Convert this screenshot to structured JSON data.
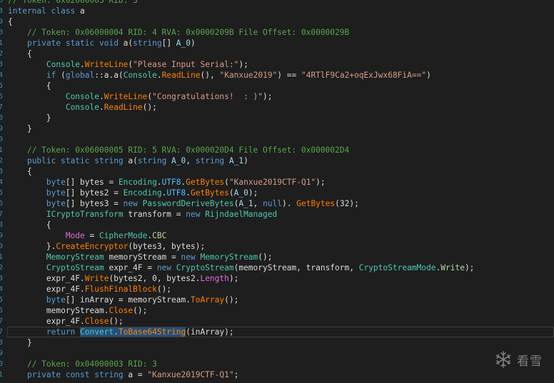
{
  "colors": {
    "background": "#1e1e1e",
    "keyword": "#569cd6",
    "comment": "#57a64a",
    "string": "#d69d85",
    "class": "#4ec9b0",
    "method": "#ff8000",
    "property": "#da70d6",
    "selection": "#264f78",
    "line_number": "#2b91af"
  },
  "watermark": {
    "icon": "snowflake-icon",
    "text": "看雪"
  },
  "current_line_index": 31,
  "lines": [
    {
      "n": "6",
      "tokens": [
        [
          "com",
          "// Token: 0x02000003 RID: 3"
        ]
      ]
    },
    {
      "n": "3",
      "tokens": [
        [
          "kw",
          "internal class "
        ],
        [
          "id",
          "a"
        ]
      ]
    },
    {
      "n": "9",
      "tokens": [
        [
          "id",
          "{"
        ]
      ]
    },
    {
      "n": "0",
      "tokens": [
        [
          "id",
          "    "
        ],
        [
          "com",
          "// Token: 0x06000004 RID: 4 RVA: 0x0000209B File Offset: 0x0000029B"
        ]
      ]
    },
    {
      "n": "1",
      "tokens": [
        [
          "id",
          "    "
        ],
        [
          "kw",
          "private static void "
        ],
        [
          "id",
          "a("
        ],
        [
          "kw",
          "string"
        ],
        [
          "id",
          "[] "
        ],
        [
          "param",
          "A_0"
        ],
        [
          "id",
          ")"
        ]
      ]
    },
    {
      "n": "2",
      "tokens": [
        [
          "id",
          "    {"
        ]
      ]
    },
    {
      "n": "3",
      "tokens": [
        [
          "id",
          "        "
        ],
        [
          "cls",
          "Console"
        ],
        [
          "id",
          "."
        ],
        [
          "mth",
          "WriteLine"
        ],
        [
          "id",
          "("
        ],
        [
          "str",
          "\"Please Input Serial:\""
        ],
        [
          "id",
          ");"
        ]
      ]
    },
    {
      "n": "4",
      "tokens": [
        [
          "id",
          "        "
        ],
        [
          "kw",
          "if "
        ],
        [
          "id",
          "("
        ],
        [
          "kw",
          "global"
        ],
        [
          "id",
          "::a.a("
        ],
        [
          "cls",
          "Console"
        ],
        [
          "id",
          "."
        ],
        [
          "mth",
          "ReadLine"
        ],
        [
          "id",
          "(), "
        ],
        [
          "str",
          "\"Kanxue2019\""
        ],
        [
          "id",
          ") == "
        ],
        [
          "str",
          "\"4RTlF9Ca2+oqExJwx68FiA==\""
        ],
        [
          "id",
          ")"
        ]
      ]
    },
    {
      "n": "5",
      "tokens": [
        [
          "id",
          "        {"
        ]
      ]
    },
    {
      "n": "6",
      "tokens": [
        [
          "id",
          "            "
        ],
        [
          "cls",
          "Console"
        ],
        [
          "id",
          "."
        ],
        [
          "mth",
          "WriteLine"
        ],
        [
          "id",
          "("
        ],
        [
          "str",
          "\"Congratulations!  : )\""
        ],
        [
          "id",
          ");"
        ]
      ]
    },
    {
      "n": "7",
      "tokens": [
        [
          "id",
          "            "
        ],
        [
          "cls",
          "Console"
        ],
        [
          "id",
          "."
        ],
        [
          "mth",
          "ReadLine"
        ],
        [
          "id",
          "();"
        ]
      ]
    },
    {
      "n": "8",
      "tokens": [
        [
          "id",
          "        }"
        ]
      ]
    },
    {
      "n": "9",
      "tokens": [
        [
          "id",
          "    }"
        ]
      ]
    },
    {
      "n": "0",
      "tokens": [
        [
          "id",
          ""
        ]
      ]
    },
    {
      "n": "1",
      "tokens": [
        [
          "id",
          "    "
        ],
        [
          "com",
          "// Token: 0x06000005 RID: 5 RVA: 0x000020D4 File Offset: 0x000002D4"
        ]
      ]
    },
    {
      "n": "2",
      "tokens": [
        [
          "id",
          "    "
        ],
        [
          "kw",
          "public static string "
        ],
        [
          "id",
          "a("
        ],
        [
          "kw",
          "string "
        ],
        [
          "param",
          "A_0"
        ],
        [
          "id",
          ", "
        ],
        [
          "kw",
          "string "
        ],
        [
          "param",
          "A_1"
        ],
        [
          "id",
          ")"
        ]
      ]
    },
    {
      "n": "3",
      "tokens": [
        [
          "id",
          "    {"
        ]
      ]
    },
    {
      "n": "4",
      "tokens": [
        [
          "id",
          "        "
        ],
        [
          "kw",
          "byte"
        ],
        [
          "id",
          "[] bytes = "
        ],
        [
          "cls",
          "Encoding"
        ],
        [
          "id",
          "."
        ],
        [
          "const",
          "UTF8"
        ],
        [
          "id",
          "."
        ],
        [
          "mth",
          "GetBytes"
        ],
        [
          "id",
          "("
        ],
        [
          "str",
          "\"Kanxue2019CTF-Q1\""
        ],
        [
          "id",
          ");"
        ]
      ]
    },
    {
      "n": "5",
      "tokens": [
        [
          "id",
          "        "
        ],
        [
          "kw",
          "byte"
        ],
        [
          "id",
          "[] bytes2 = "
        ],
        [
          "cls",
          "Encoding"
        ],
        [
          "id",
          "."
        ],
        [
          "const",
          "UTF8"
        ],
        [
          "id",
          "."
        ],
        [
          "mth",
          "GetBytes"
        ],
        [
          "id",
          "("
        ],
        [
          "param",
          "A_0"
        ],
        [
          "id",
          ");"
        ]
      ]
    },
    {
      "n": "6",
      "tokens": [
        [
          "id",
          "        "
        ],
        [
          "kw",
          "byte"
        ],
        [
          "id",
          "[] bytes3 = "
        ],
        [
          "kw",
          "new "
        ],
        [
          "cls",
          "PasswordDeriveBytes"
        ],
        [
          "id",
          "("
        ],
        [
          "param",
          "A_1"
        ],
        [
          "id",
          ", "
        ],
        [
          "kw",
          "null"
        ],
        [
          "id",
          "). "
        ],
        [
          "mth",
          "GetBytes"
        ],
        [
          "id",
          "(32);"
        ]
      ]
    },
    {
      "n": "7",
      "tokens": [
        [
          "id",
          "        "
        ],
        [
          "cls",
          "ICryptoTransform"
        ],
        [
          "id",
          " transform = "
        ],
        [
          "kw",
          "new "
        ],
        [
          "cls",
          "RijndaelManaged"
        ]
      ]
    },
    {
      "n": "8",
      "tokens": [
        [
          "id",
          "        {"
        ]
      ]
    },
    {
      "n": "9",
      "tokens": [
        [
          "id",
          "            "
        ],
        [
          "prop",
          "Mode"
        ],
        [
          "id",
          " = "
        ],
        [
          "cls",
          "CipherMode"
        ],
        [
          "id",
          "."
        ],
        [
          "enum",
          "CBC"
        ]
      ]
    },
    {
      "n": "0",
      "tokens": [
        [
          "id",
          "        }."
        ],
        [
          "mth",
          "CreateEncryptor"
        ],
        [
          "id",
          "(bytes3, bytes);"
        ]
      ]
    },
    {
      "n": "1",
      "tokens": [
        [
          "id",
          "        "
        ],
        [
          "cls",
          "MemoryStream"
        ],
        [
          "id",
          " memoryStream = "
        ],
        [
          "kw",
          "new "
        ],
        [
          "cls",
          "MemoryStream"
        ],
        [
          "id",
          "();"
        ]
      ]
    },
    {
      "n": "2",
      "tokens": [
        [
          "id",
          "        "
        ],
        [
          "cls",
          "CryptoStream"
        ],
        [
          "id",
          " expr_4F = "
        ],
        [
          "kw",
          "new "
        ],
        [
          "cls",
          "CryptoStream"
        ],
        [
          "id",
          "(memoryStream, transform, "
        ],
        [
          "cls",
          "CryptoStreamMode"
        ],
        [
          "id",
          "."
        ],
        [
          "enum",
          "Write"
        ],
        [
          "id",
          ");"
        ]
      ]
    },
    {
      "n": "3",
      "tokens": [
        [
          "id",
          "        expr_4F."
        ],
        [
          "mth",
          "Write"
        ],
        [
          "id",
          "(bytes2, 0, bytes2."
        ],
        [
          "prop",
          "Length"
        ],
        [
          "id",
          ");"
        ]
      ]
    },
    {
      "n": "4",
      "tokens": [
        [
          "id",
          "        expr_4F."
        ],
        [
          "mth",
          "FlushFinalBlock"
        ],
        [
          "id",
          "();"
        ]
      ]
    },
    {
      "n": "5",
      "tokens": [
        [
          "id",
          "        "
        ],
        [
          "kw",
          "byte"
        ],
        [
          "id",
          "[] inArray = memoryStream."
        ],
        [
          "mth",
          "ToArray"
        ],
        [
          "id",
          "();"
        ]
      ]
    },
    {
      "n": "6",
      "tokens": [
        [
          "id",
          "        memoryStream."
        ],
        [
          "mth",
          "Close"
        ],
        [
          "id",
          "();"
        ]
      ]
    },
    {
      "n": "7",
      "tokens": [
        [
          "id",
          "        expr_4F."
        ],
        [
          "mth",
          "Close"
        ],
        [
          "id",
          "();"
        ]
      ]
    },
    {
      "n": "7",
      "tokens": [
        [
          "id",
          "        "
        ],
        [
          "kw",
          "return "
        ],
        [
          "cls sel",
          "Convert"
        ],
        [
          "id sel",
          "."
        ],
        [
          "mth sel",
          "ToBase64String"
        ],
        [
          "id",
          "(inArray);"
        ]
      ]
    },
    {
      "n": "8",
      "tokens": [
        [
          "id",
          "    }"
        ]
      ]
    },
    {
      "n": "9",
      "tokens": [
        [
          "id",
          ""
        ]
      ]
    },
    {
      "n": "0",
      "tokens": [
        [
          "id",
          "    "
        ],
        [
          "com",
          "// Token: 0x04000003 RID: 3"
        ]
      ]
    },
    {
      "n": "1",
      "tokens": [
        [
          "id",
          "    "
        ],
        [
          "kw",
          "private const string "
        ],
        [
          "id",
          "a = "
        ],
        [
          "str",
          "\"Kanxue2019CTF-Q1\""
        ],
        [
          "id",
          ";"
        ]
      ]
    }
  ]
}
